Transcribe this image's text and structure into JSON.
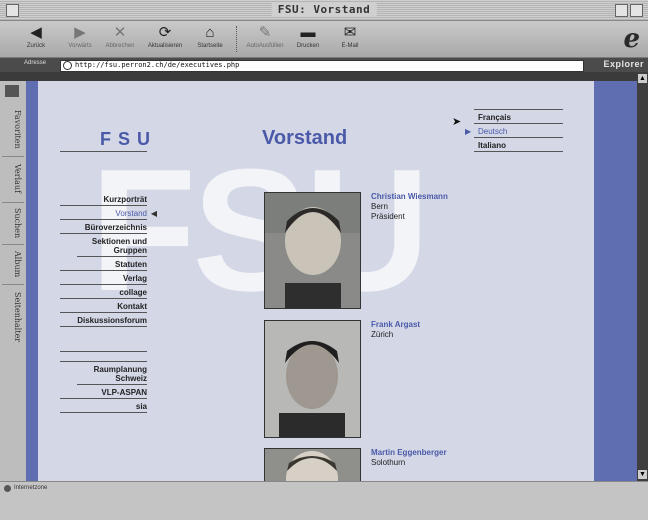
{
  "window": {
    "title": "FSU: Vorstand"
  },
  "toolbar": {
    "back": "Zurück",
    "forward": "Vorwärts",
    "stop": "Abbrechen",
    "refresh": "Aktualisieren",
    "home": "Startseite",
    "autofill": "AutoAusfüllen",
    "print": "Drucken",
    "mail": "E-Mail"
  },
  "address": {
    "label": "Adresse",
    "url": "http://fsu.perron2.ch/de/executives.php",
    "brand": "Explorer"
  },
  "sidebar_tabs": [
    "Favoriten",
    "Verlauf",
    "Suchen",
    "Album",
    "Seitenhalter"
  ],
  "page": {
    "logo": "FSU",
    "watermark": "FSU",
    "heading": "Vorstand",
    "nav": [
      {
        "label": "Kurzporträt",
        "active": false
      },
      {
        "label": "Vorstand",
        "active": true
      },
      {
        "label": "Büroverzeichnis",
        "active": false
      },
      {
        "label": "Sektionen und Gruppen",
        "active": false
      },
      {
        "label": "Statuten",
        "active": false
      },
      {
        "label": "Verlag",
        "active": false
      },
      {
        "label": "collage",
        "active": false
      },
      {
        "label": "Kontakt",
        "active": false
      },
      {
        "label": "Diskussionsforum",
        "active": false
      }
    ],
    "nav_secondary": [
      "Raumplanung Schweiz",
      "VLP-ASPAN",
      "sia"
    ],
    "languages": [
      {
        "label": "Français",
        "active": false
      },
      {
        "label": "Deutsch",
        "active": true
      },
      {
        "label": "Italiano",
        "active": false
      }
    ],
    "people": [
      {
        "name": "Christian Wiesmann",
        "city": "Bern",
        "role": "Präsident"
      },
      {
        "name": "Frank Argast",
        "city": "Zürich",
        "role": ""
      },
      {
        "name": "Martin Eggenberger",
        "city": "Solothurn",
        "role": ""
      }
    ]
  },
  "status": {
    "zone": "Internetzone"
  },
  "colors": {
    "accent": "#4a5aa8",
    "page_bg": "#d3d7e6",
    "frame_bg": "#5f6eb0"
  }
}
